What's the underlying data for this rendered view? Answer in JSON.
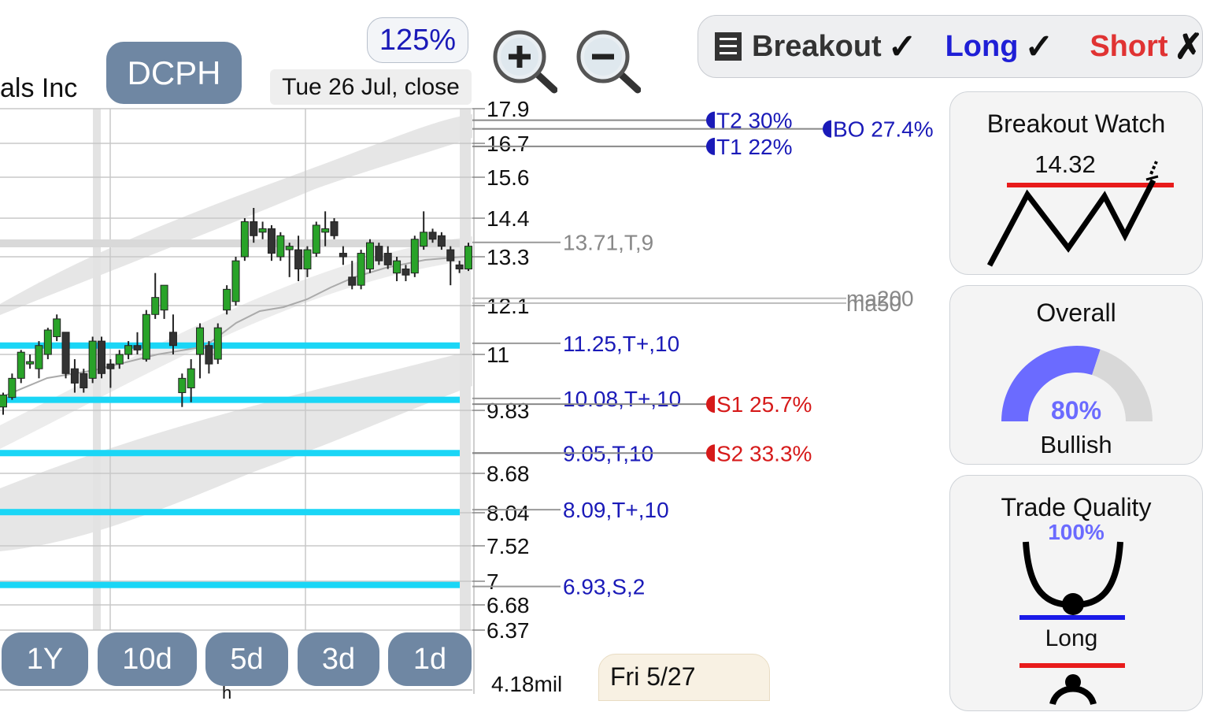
{
  "header": {
    "company_partial": "als Inc",
    "ticker": "DCPH",
    "zoom_level": "125%",
    "date_label": "Tue 26 Jul, close"
  },
  "mode_bar": {
    "breakout_label": "Breakout",
    "breakout_mark": "✓",
    "long_label": "Long",
    "long_mark": "✓",
    "short_label": "Short",
    "short_mark": "✗",
    "colors": {
      "breakout": "#333333",
      "long": "#1f1fd6",
      "short": "#e03333"
    }
  },
  "range_buttons": [
    "1Y",
    "10d",
    "5d",
    "3d",
    "1d"
  ],
  "cards": {
    "breakout_watch": {
      "title": "Breakout Watch",
      "value": "14.32"
    },
    "overall": {
      "title": "Overall",
      "percent": "80%",
      "fraction": 0.8,
      "label": "Bullish"
    },
    "trade_quality": {
      "title": "Trade Quality",
      "percent": "100%",
      "label": "Long"
    }
  },
  "bottom": {
    "volume_label": "4.18mil",
    "date_tip": "Fri 5/27",
    "cut_label": "h"
  },
  "chart_data": {
    "type": "candlestick",
    "price_ticks": [
      "17.9",
      "16.7",
      "15.6",
      "14.4",
      "13.3",
      "12.1",
      "11",
      "9.83",
      "8.68",
      "8.04",
      "7.52",
      "7",
      "6.68",
      "6.37"
    ],
    "tick_values": [
      17.9,
      16.7,
      15.6,
      14.4,
      13.3,
      12.1,
      11,
      9.83,
      8.68,
      8.04,
      7.52,
      7,
      6.68,
      6.37
    ],
    "levels": [
      {
        "label": "13.71,T,9",
        "value": 13.71,
        "color": "#888888"
      },
      {
        "label": "11.25,T+,10",
        "value": 11.25,
        "color": "#1a1ab8"
      },
      {
        "label": "10.08,T+,10",
        "value": 10.08,
        "color": "#1a1ab8"
      },
      {
        "label": "9.05,T,10",
        "value": 9.05,
        "color": "#1a1ab8"
      },
      {
        "label": "8.09,T+,10",
        "value": 8.09,
        "color": "#1a1ab8"
      },
      {
        "label": "6.93,S,2",
        "value": 6.93,
        "color": "#1a1ab8"
      }
    ],
    "support_lines": [
      11.2,
      10.05,
      9.05,
      8.05,
      6.95
    ],
    "targets": [
      {
        "label": "T2 30%",
        "value": 17.5,
        "color": "#1a1ab8"
      },
      {
        "label": "T1 22%",
        "value": 16.6,
        "color": "#1a1ab8"
      },
      {
        "label": "BO 27.4%",
        "value": 17.2,
        "color": "#1a1ab8"
      },
      {
        "label": "S1 25.7%",
        "value": 9.96,
        "color": "#d61a1a"
      },
      {
        "label": "S2 33.3%",
        "value": 9.05,
        "color": "#d61a1a"
      }
    ],
    "ma_labels": [
      {
        "label": "ma200",
        "value": 12.28
      },
      {
        "label": "ma50",
        "value": 12.16
      }
    ],
    "candles": [
      {
        "o": 9.9,
        "h": 10.2,
        "l": 9.75,
        "c": 10.15
      },
      {
        "o": 10.1,
        "h": 10.6,
        "l": 10.05,
        "c": 10.5
      },
      {
        "o": 10.5,
        "h": 11.1,
        "l": 10.4,
        "c": 11.05
      },
      {
        "o": 10.8,
        "h": 11.0,
        "l": 10.7,
        "c": 10.85
      },
      {
        "o": 10.7,
        "h": 11.3,
        "l": 10.5,
        "c": 11.2
      },
      {
        "o": 11.0,
        "h": 11.6,
        "l": 10.9,
        "c": 11.55
      },
      {
        "o": 11.4,
        "h": 11.9,
        "l": 11.3,
        "c": 11.8
      },
      {
        "o": 11.5,
        "h": 11.5,
        "l": 10.5,
        "c": 10.6
      },
      {
        "o": 10.7,
        "h": 10.9,
        "l": 10.2,
        "c": 10.4
      },
      {
        "o": 10.6,
        "h": 10.7,
        "l": 10.2,
        "c": 10.3
      },
      {
        "o": 10.5,
        "h": 11.4,
        "l": 10.4,
        "c": 11.3
      },
      {
        "o": 11.3,
        "h": 11.4,
        "l": 10.5,
        "c": 10.6
      },
      {
        "o": 10.8,
        "h": 10.9,
        "l": 10.3,
        "c": 10.7
      },
      {
        "o": 10.8,
        "h": 11.1,
        "l": 10.7,
        "c": 11.0
      },
      {
        "o": 11.0,
        "h": 11.3,
        "l": 10.9,
        "c": 11.2
      },
      {
        "o": 11.2,
        "h": 11.5,
        "l": 11.0,
        "c": 11.1
      },
      {
        "o": 10.9,
        "h": 12.0,
        "l": 10.85,
        "c": 11.9
      },
      {
        "o": 11.9,
        "h": 12.9,
        "l": 11.8,
        "c": 12.3
      },
      {
        "o": 12.0,
        "h": 12.6,
        "l": 11.8,
        "c": 12.6
      },
      {
        "o": 11.5,
        "h": 11.9,
        "l": 11.0,
        "c": 11.2
      },
      {
        "o": 10.2,
        "h": 10.6,
        "l": 9.9,
        "c": 10.5
      },
      {
        "o": 10.3,
        "h": 10.9,
        "l": 10.0,
        "c": 10.7
      },
      {
        "o": 11.0,
        "h": 11.7,
        "l": 10.5,
        "c": 11.6
      },
      {
        "o": 11.2,
        "h": 11.3,
        "l": 10.6,
        "c": 10.8
      },
      {
        "o": 10.9,
        "h": 11.7,
        "l": 10.8,
        "c": 11.6
      },
      {
        "o": 12.0,
        "h": 12.6,
        "l": 11.9,
        "c": 12.5
      },
      {
        "o": 12.2,
        "h": 13.3,
        "l": 12.1,
        "c": 13.2
      },
      {
        "o": 13.3,
        "h": 14.4,
        "l": 13.2,
        "c": 14.3
      },
      {
        "o": 14.3,
        "h": 14.7,
        "l": 13.7,
        "c": 13.9
      },
      {
        "o": 14.0,
        "h": 14.3,
        "l": 13.8,
        "c": 14.1
      },
      {
        "o": 14.1,
        "h": 14.2,
        "l": 13.2,
        "c": 13.4
      },
      {
        "o": 13.3,
        "h": 14.0,
        "l": 13.2,
        "c": 13.9
      },
      {
        "o": 13.5,
        "h": 13.7,
        "l": 12.8,
        "c": 13.6
      },
      {
        "o": 13.5,
        "h": 13.9,
        "l": 12.7,
        "c": 13.0
      },
      {
        "o": 13.0,
        "h": 13.6,
        "l": 12.8,
        "c": 13.5
      },
      {
        "o": 13.4,
        "h": 14.3,
        "l": 13.3,
        "c": 14.2
      },
      {
        "o": 14.0,
        "h": 14.6,
        "l": 13.6,
        "c": 14.1
      },
      {
        "o": 14.3,
        "h": 14.4,
        "l": 13.8,
        "c": 13.9
      },
      {
        "o": 13.4,
        "h": 13.6,
        "l": 13.1,
        "c": 13.3
      },
      {
        "o": 12.8,
        "h": 13.2,
        "l": 12.5,
        "c": 12.6
      },
      {
        "o": 12.6,
        "h": 13.5,
        "l": 12.5,
        "c": 13.4
      },
      {
        "o": 13.0,
        "h": 13.8,
        "l": 12.9,
        "c": 13.7
      },
      {
        "o": 13.6,
        "h": 13.7,
        "l": 13.1,
        "c": 13.2
      },
      {
        "o": 13.4,
        "h": 13.6,
        "l": 13.0,
        "c": 13.1
      },
      {
        "o": 12.9,
        "h": 13.3,
        "l": 12.7,
        "c": 13.2
      },
      {
        "o": 13.0,
        "h": 13.1,
        "l": 12.7,
        "c": 12.85
      },
      {
        "o": 12.9,
        "h": 13.9,
        "l": 12.8,
        "c": 13.8
      },
      {
        "o": 13.6,
        "h": 14.6,
        "l": 13.5,
        "c": 14.0
      },
      {
        "o": 14.0,
        "h": 14.1,
        "l": 13.7,
        "c": 13.8
      },
      {
        "o": 13.9,
        "h": 14.0,
        "l": 13.5,
        "c": 13.6
      },
      {
        "o": 13.5,
        "h": 13.6,
        "l": 12.6,
        "c": 13.2
      },
      {
        "o": 13.1,
        "h": 13.2,
        "l": 12.9,
        "c": 13.0
      },
      {
        "o": 13.0,
        "h": 13.7,
        "l": 12.95,
        "c": 13.6
      }
    ]
  }
}
